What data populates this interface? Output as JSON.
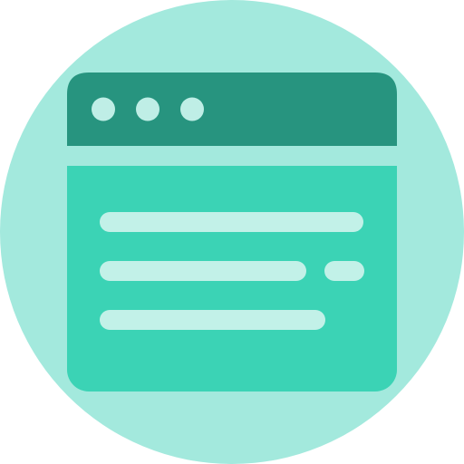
{
  "icon": {
    "name": "browser-window-icon",
    "colors": {
      "background_circle": "#A3E9DD",
      "title_bar": "#27947F",
      "window_body": "#3BD3B5",
      "dots": "#BFEEE6",
      "text_lines": "#C2F1E8"
    },
    "window_controls": [
      "dot",
      "dot",
      "dot"
    ],
    "content_lines": [
      "line",
      "line",
      "line",
      "short-line"
    ]
  }
}
